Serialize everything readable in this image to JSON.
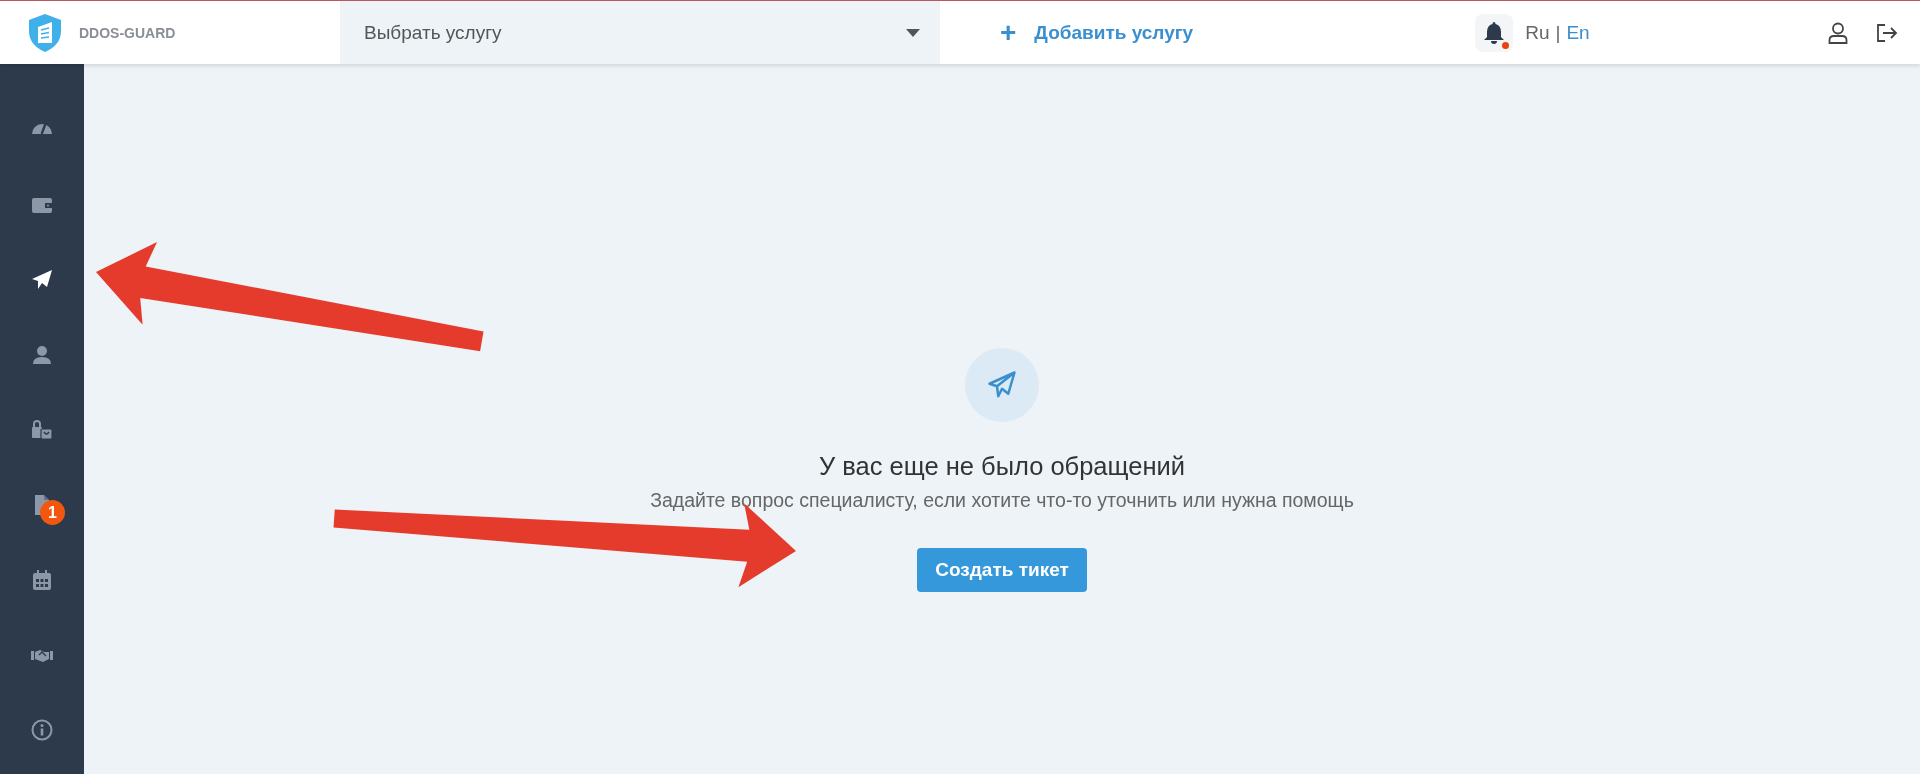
{
  "header": {
    "brand": "DDOS-GUARD",
    "service_select": {
      "value": "Выбрать услугу"
    },
    "add_service": {
      "icon": "+",
      "label": "Добавить услугу"
    },
    "notifications": {
      "unread": true
    },
    "languages": [
      {
        "label": "Ru",
        "selected": true
      },
      {
        "label": "En",
        "selected": false
      }
    ],
    "language_separator": "|"
  },
  "sidebar": {
    "items": [
      {
        "selected": false
      },
      {
        "selected": false
      },
      {
        "selected": true
      },
      {
        "selected": false
      },
      {
        "selected": false
      },
      {
        "selected": false,
        "badge": "1"
      },
      {
        "selected": false
      },
      {
        "selected": false
      },
      {
        "selected": false
      }
    ]
  },
  "empty_state": {
    "title": "У вас еще не было обращений",
    "text": "Задайте вопрос специалисту, если хотите что-то уточнить или нужна помощь",
    "button": "Создать тикет"
  },
  "annotation_arrows": [
    {
      "kind": "arrow"
    },
    {
      "kind": "arrow"
    }
  ]
}
